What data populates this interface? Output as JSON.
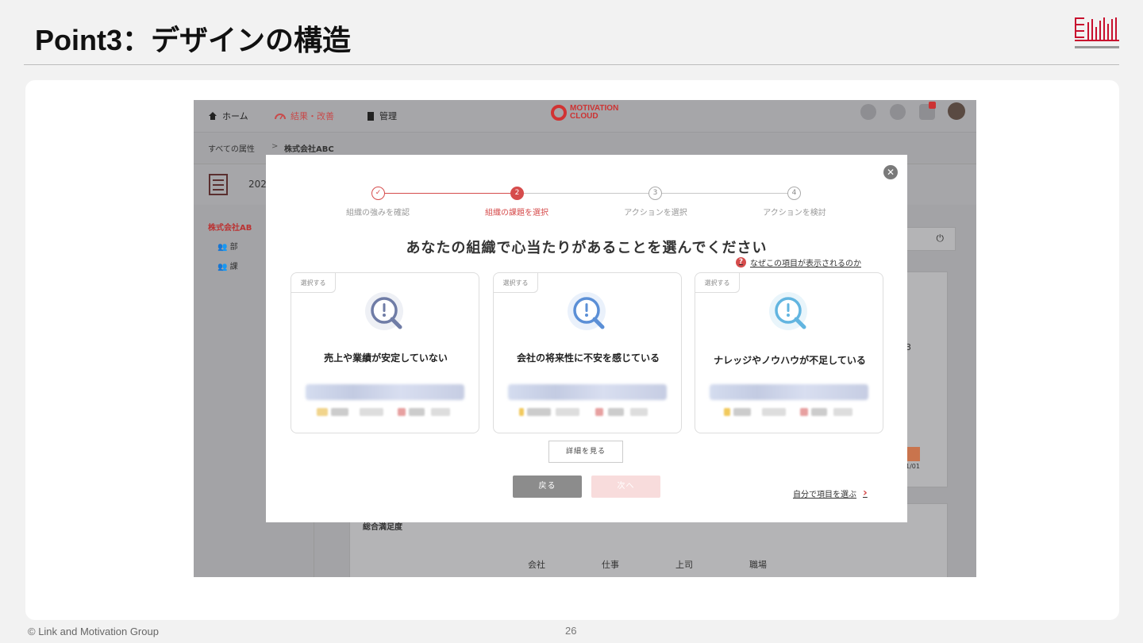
{
  "slide": {
    "title": "Point3：デザインの構造",
    "footer_copyright": "© Link and Motivation Group",
    "page_number": "26"
  },
  "app": {
    "nav": [
      {
        "label": "ホーム",
        "icon": "home-icon"
      },
      {
        "label": "結果・改善",
        "icon": "gauge-icon",
        "active": true
      },
      {
        "label": "管理",
        "icon": "clipboard-icon"
      }
    ],
    "brand_line1": "MOTIVATION",
    "brand_line2": "CLOUD",
    "notification_count": "1",
    "breadcrumb": [
      "すべての属性",
      "株式会社ABC"
    ],
    "subbar_text": "202",
    "sidebar": [
      {
        "label": "株式会社AB",
        "active": true
      },
      {
        "label": "部"
      },
      {
        "label": "課"
      }
    ],
    "bg_value": "3",
    "bg_date": "1/01",
    "bg_section_title": "総合満足度",
    "bg_columns": [
      "会社",
      "仕事",
      "上司",
      "職場"
    ]
  },
  "modal": {
    "steps": [
      {
        "number": "✓",
        "label": "組織の強みを確認",
        "state": "done"
      },
      {
        "number": "2",
        "label": "組織の課題を選択",
        "state": "current"
      },
      {
        "number": "3",
        "label": "アクションを選択",
        "state": "todo"
      },
      {
        "number": "4",
        "label": "アクションを検討",
        "state": "todo"
      }
    ],
    "heading": "あなたの組織で心当たりがあることを選んでください",
    "why_link": "なぜこの項目が表示されるのか",
    "options": [
      {
        "tag": "選択する",
        "title": "売上や業績が安定していない",
        "icon_color": "#6f7ca6"
      },
      {
        "tag": "選択する",
        "title": "会社の将来性に不安を感じている",
        "icon_color": "#5b8fd6"
      },
      {
        "tag": "選択する",
        "title": "ナレッジやノウハウが不足している",
        "icon_color": "#62b5e0"
      }
    ],
    "detail_button": "詳細を見る",
    "back_button": "戻る",
    "next_button": "次へ",
    "self_select_link": "自分で項目を選ぶ"
  },
  "colors": {
    "accent": "#d64c4c",
    "overlay": "#a3a3a6"
  }
}
